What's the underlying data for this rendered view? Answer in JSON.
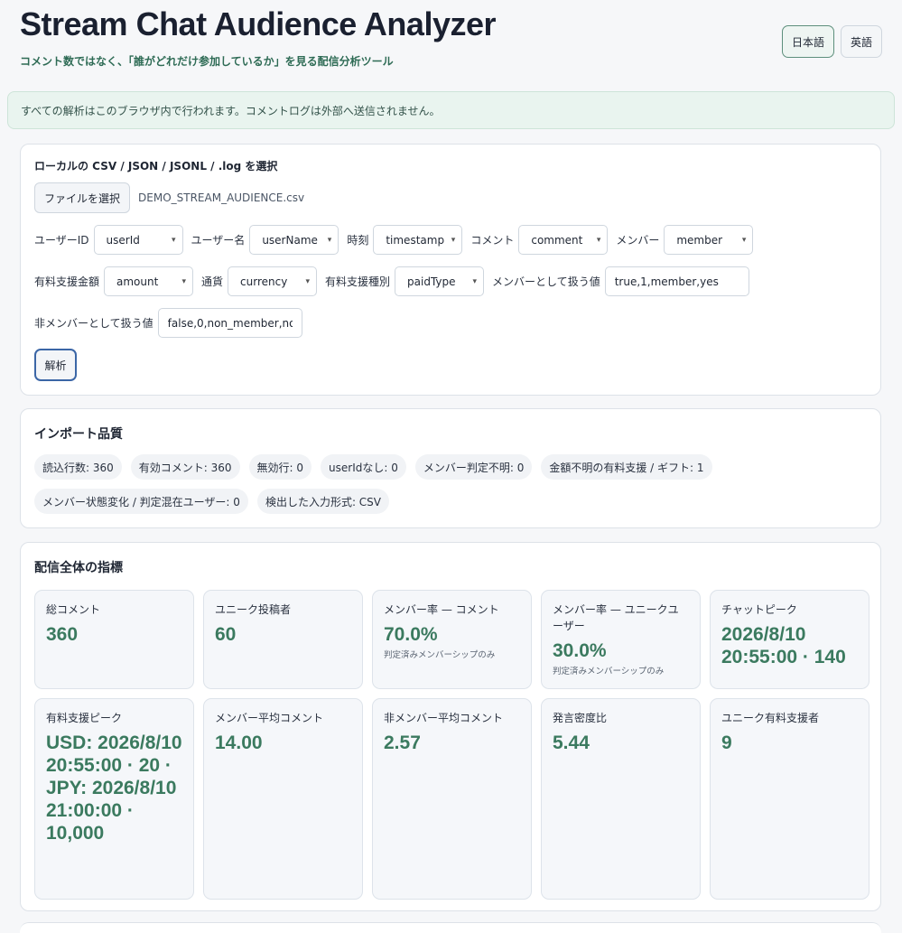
{
  "header": {
    "title": "Stream Chat Audience Analyzer",
    "subtitle": "コメント数ではなく、「誰がどれだけ参加しているか」を見る配信分析ツール",
    "lang_ja": "日本語",
    "lang_en": "英語"
  },
  "notice": "すべての解析はこのブラウザ内で行われます。コメントログは外部へ送信されません。",
  "upload": {
    "label": "ローカルの CSV / JSON / JSONL / .log を選択",
    "file_button": "ファイルを選択",
    "file_name": "DEMO_STREAM_AUDIENCE.csv",
    "fields": {
      "userid_label": "ユーザーID",
      "userid_value": "userId",
      "username_label": "ユーザー名",
      "username_value": "userName",
      "time_label": "時刻",
      "time_value": "timestamp",
      "comment_label": "コメント",
      "comment_value": "comment",
      "member_label": "メンバー",
      "member_value": "member",
      "amount_label": "有料支援金額",
      "amount_value": "amount",
      "currency_label": "通貨",
      "currency_value": "currency",
      "paidtype_label": "有料支援種別",
      "paidtype_value": "paidType",
      "member_true_label": "メンバーとして扱う値",
      "member_true_value": "true,1,member,yes",
      "member_false_label": "非メンバーとして扱う値",
      "member_false_value": "false,0,non_member,no"
    },
    "analyze_button": "解析"
  },
  "quality": {
    "title": "インポート品質",
    "chips": [
      "読込行数: 360",
      "有効コメント: 360",
      "無効行: 0",
      "userIdなし: 0",
      "メンバー判定不明: 0",
      "金額不明の有料支援 / ギフト: 1",
      "メンバー状態変化 / 判定混在ユーザー: 0",
      "検出した入力形式: CSV"
    ]
  },
  "metrics": {
    "title": "配信全体の指標",
    "tiles": [
      {
        "label": "総コメント",
        "value": "360"
      },
      {
        "label": "ユニーク投稿者",
        "value": "60"
      },
      {
        "label": "メンバー率 — コメント",
        "value": "70.0%",
        "note": "判定済みメンバーシップのみ"
      },
      {
        "label": "メンバー率 — ユニークユーザー",
        "value": "30.0%",
        "note": "判定済みメンバーシップのみ"
      },
      {
        "label": "チャットピーク",
        "value": "2026/8/10 20:55:00 · 140"
      },
      {
        "label": "有料支援ピーク",
        "value": "USD: 2026/8/10 20:55:00 · 20 · JPY: 2026/8/10 21:00:00 · 10,000"
      },
      {
        "label": "メンバー平均コメント",
        "value": "14.00"
      },
      {
        "label": "非メンバー平均コメント",
        "value": "2.57"
      },
      {
        "label": "発言密度比",
        "value": "5.44"
      },
      {
        "label": "ユニーク有料支援者",
        "value": "9"
      }
    ]
  }
}
